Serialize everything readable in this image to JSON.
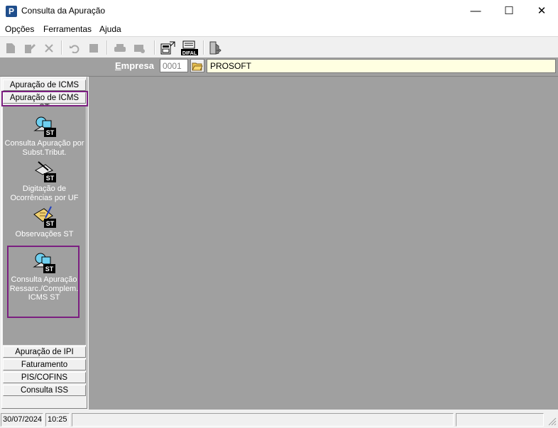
{
  "window": {
    "title": "Consulta da Apuração",
    "app_icon_letter": "P",
    "controls": {
      "minimize": "—",
      "maximize": "☐",
      "close": "✕"
    }
  },
  "menu": [
    "Opções",
    "Ferramentas",
    "Ajuda"
  ],
  "toolbar": {
    "icons": [
      "new-icon",
      "edit-icon",
      "delete-icon",
      "undo-icon",
      "stop-icon",
      "print-icon",
      "print-preview-icon",
      "export-icon",
      "difal-icon",
      "exit-icon"
    ],
    "difal_label": "DIFAL"
  },
  "empresa": {
    "label": "Empresa",
    "code": "0001",
    "name": "PROSOFT"
  },
  "left_panel": {
    "groups_top": [
      "Apuração de ICMS",
      "Apuração de ICMS ST"
    ],
    "items": [
      {
        "label": "Consulta Apuração por Subst.Tribut.",
        "icon": "consulta-st-icon"
      },
      {
        "label": "Digitação de Ocorrências por UF",
        "icon": "digitacao-st-icon"
      },
      {
        "label": "Observações ST",
        "icon": "observacoes-st-icon"
      },
      {
        "label": "Consulta Apuração Ressarc./Complem. ICMS ST",
        "icon": "consulta-ressarc-st-icon"
      }
    ],
    "icon_badge": "ST",
    "groups_bottom": [
      "Apuração de IPI",
      "Faturamento",
      "PIS/COFINS",
      "Consulta ISS"
    ]
  },
  "status": {
    "date": "30/07/2024",
    "time": "10:25"
  },
  "colors": {
    "highlight": "#7b1f80",
    "workspace": "#a0a0a0",
    "empresa_name_bg": "#ffffe1"
  }
}
